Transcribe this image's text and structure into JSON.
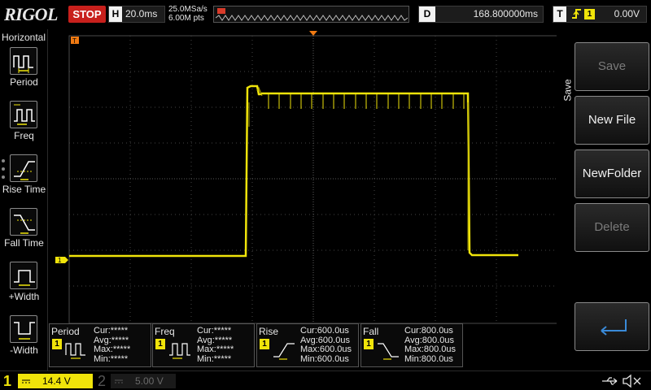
{
  "topbar": {
    "brand": "RIGOL",
    "run_status": "STOP",
    "timebase_key": "H",
    "timebase": "20.0ms",
    "sample_rate": "25.0MSa/s",
    "memory_depth": "6.00M pts",
    "delay_key": "D",
    "delay": "168.800000ms",
    "trigger_key": "T",
    "trigger_source": "1",
    "trigger_level": "0.00V"
  },
  "left_menu": {
    "title": "Horizontal",
    "items": [
      {
        "label": "Period",
        "icon": "period-icon"
      },
      {
        "label": "Freq",
        "icon": "freq-icon"
      },
      {
        "label": "Rise Time",
        "icon": "rise-time-icon"
      },
      {
        "label": "Fall Time",
        "icon": "fall-time-icon"
      },
      {
        "label": "+Width",
        "icon": "positive-width-icon"
      },
      {
        "label": "-Width",
        "icon": "negative-width-icon"
      }
    ]
  },
  "markers": {
    "trigger_marker": "T",
    "ch1_marker": "1"
  },
  "measurements": [
    {
      "name": "Period",
      "channel": "1",
      "cur": "Cur:*****",
      "avg": "Avg:*****",
      "max": "Max:*****",
      "min": "Min:*****"
    },
    {
      "name": "Freq",
      "channel": "1",
      "cur": "Cur:*****",
      "avg": "Avg:*****",
      "max": "Max:*****",
      "min": "Min:*****"
    },
    {
      "name": "Rise",
      "channel": "1",
      "cur": "Cur:600.0us",
      "avg": "Avg:600.0us",
      "max": "Max:600.0us",
      "min": "Min:600.0us"
    },
    {
      "name": "Fall",
      "channel": "1",
      "cur": "Cur:800.0us",
      "avg": "Avg:800.0us",
      "max": "Max:800.0us",
      "min": "Min:800.0us"
    }
  ],
  "right_menu": {
    "tab": "Save",
    "buttons": [
      {
        "label": "Save",
        "enabled": false
      },
      {
        "label": "New File",
        "enabled": true
      },
      {
        "label": "NewFolder",
        "enabled": true
      },
      {
        "label": "Delete",
        "enabled": false
      }
    ],
    "return_icon": "return-arrow-icon"
  },
  "bottombar": {
    "ch1_num": "1",
    "ch1_scale": "14.4 V",
    "ch2_num": "2",
    "ch2_scale": "5.00 V",
    "status_icons": [
      "usb-icon",
      "speaker-muted-icon"
    ]
  },
  "colors": {
    "ch1": "#f0e40a",
    "stop": "#c8201c",
    "trigger_marker": "#f07a12"
  }
}
